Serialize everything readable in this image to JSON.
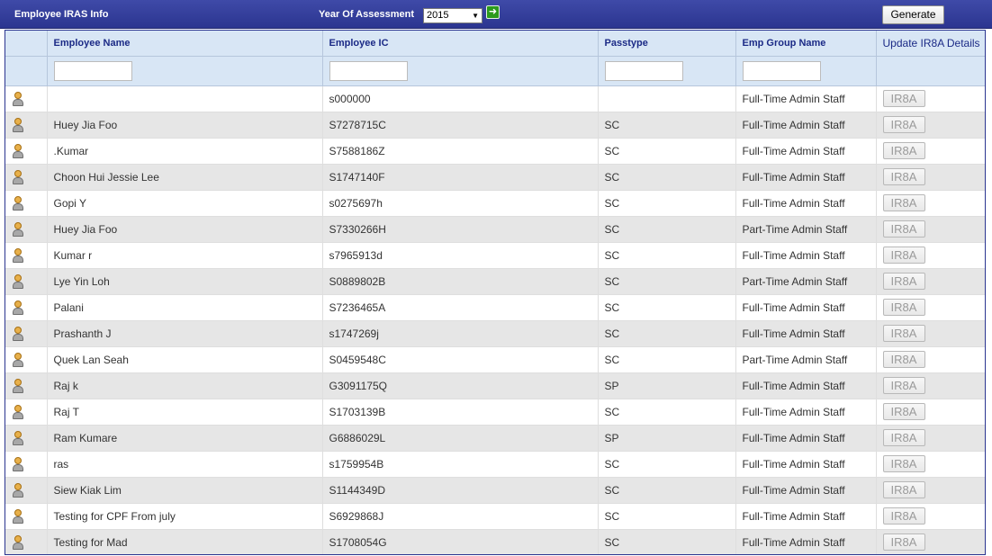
{
  "header": {
    "title": "Employee IRAS Info",
    "year_label": "Year Of Assessment",
    "year_value": "2015",
    "generate_label": "Generate"
  },
  "columns": {
    "name": "Employee Name",
    "ic": "Employee IC",
    "passtype": "Passtype",
    "group": "Emp Group Name",
    "update": "Update IR8A Details"
  },
  "ir8a_label": "IR8A",
  "rows": [
    {
      "name": "",
      "ic": "s000000",
      "passtype": "",
      "group": "Full-Time Admin Staff"
    },
    {
      "name": "Huey Jia Foo",
      "ic": "S7278715C",
      "passtype": "SC",
      "group": "Full-Time Admin Staff"
    },
    {
      "name": ".Kumar",
      "ic": "S7588186Z",
      "passtype": "SC",
      "group": "Full-Time Admin Staff"
    },
    {
      "name": "Choon Hui Jessie Lee",
      "ic": "S1747140F",
      "passtype": "SC",
      "group": "Full-Time Admin Staff"
    },
    {
      "name": "Gopi Y",
      "ic": "s0275697h",
      "passtype": "SC",
      "group": "Full-Time Admin Staff"
    },
    {
      "name": "Huey Jia Foo",
      "ic": "S7330266H",
      "passtype": "SC",
      "group": "Part-Time Admin Staff"
    },
    {
      "name": "Kumar r",
      "ic": "s7965913d",
      "passtype": "SC",
      "group": "Full-Time Admin Staff"
    },
    {
      "name": "Lye Yin Loh",
      "ic": "S0889802B",
      "passtype": "SC",
      "group": "Part-Time Admin Staff"
    },
    {
      "name": "Palani",
      "ic": "S7236465A",
      "passtype": "SC",
      "group": "Full-Time Admin Staff"
    },
    {
      "name": "Prashanth J",
      "ic": "s1747269j",
      "passtype": "SC",
      "group": "Full-Time Admin Staff"
    },
    {
      "name": "Quek Lan Seah",
      "ic": "S0459548C",
      "passtype": "SC",
      "group": "Part-Time Admin Staff"
    },
    {
      "name": "Raj k",
      "ic": "G3091175Q",
      "passtype": "SP",
      "group": "Full-Time Admin Staff"
    },
    {
      "name": "Raj T",
      "ic": "S1703139B",
      "passtype": "SC",
      "group": "Full-Time Admin Staff"
    },
    {
      "name": "Ram Kumare",
      "ic": "G6886029L",
      "passtype": "SP",
      "group": "Full-Time Admin Staff"
    },
    {
      "name": "ras",
      "ic": "s1759954B",
      "passtype": "SC",
      "group": "Full-Time Admin Staff"
    },
    {
      "name": "Siew Kiak Lim",
      "ic": "S1144349D",
      "passtype": "SC",
      "group": "Full-Time Admin Staff"
    },
    {
      "name": "Testing for CPF From july",
      "ic": "S6929868J",
      "passtype": "SC",
      "group": "Full-Time Admin Staff"
    },
    {
      "name": "Testing for Mad",
      "ic": "S1708054G",
      "passtype": "SC",
      "group": "Full-Time Admin Staff"
    }
  ]
}
